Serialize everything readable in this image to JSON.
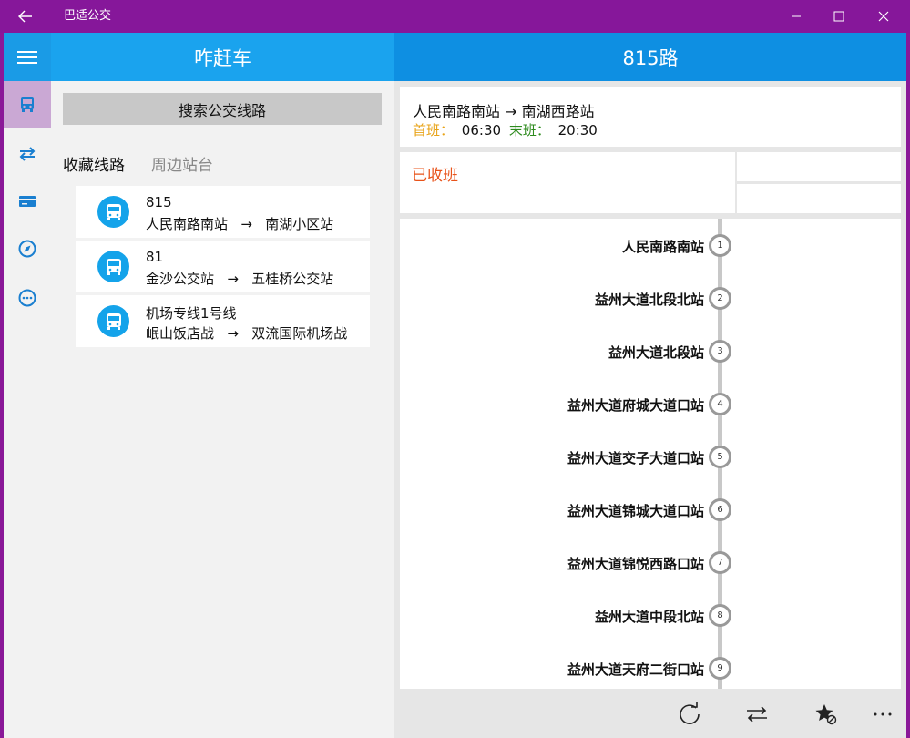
{
  "app": {
    "title": "巴适公交"
  },
  "window_controls": [
    "minimize",
    "maximize",
    "close"
  ],
  "rail": {
    "items": [
      {
        "icon": "bus-icon",
        "active": true
      },
      {
        "icon": "transfer-icon",
        "active": false
      },
      {
        "icon": "card-icon",
        "active": false
      },
      {
        "icon": "compass-icon",
        "active": false
      },
      {
        "icon": "more-circle-icon",
        "active": false
      }
    ]
  },
  "left": {
    "header": "咋赶车",
    "search_label": "搜索公交线路",
    "tabs": [
      "收藏线路",
      "周边站台"
    ],
    "routes": [
      {
        "name": "815",
        "from": "人民南路南站",
        "arrow": "→",
        "to": "南湖小区站"
      },
      {
        "name": "81",
        "from": "金沙公交站",
        "arrow": "→",
        "to": "五桂桥公交站"
      },
      {
        "name": "机场专线1号线",
        "from": "岷山饭店战",
        "arrow": "→",
        "to": "双流国际机场战"
      }
    ]
  },
  "right": {
    "header": "815路",
    "direction": "人民南路南站 → 南湖西路站",
    "first_label": "首班：",
    "first_time": "06:30",
    "last_label": "末班：",
    "last_time": "20:30",
    "status": "已收班",
    "stations": [
      {
        "name": "人民南路南站",
        "num": "1"
      },
      {
        "name": "益州大道北段北站",
        "num": "2"
      },
      {
        "name": "益州大道北段站",
        "num": "3"
      },
      {
        "name": "益州大道府城大道口站",
        "num": "4"
      },
      {
        "name": "益州大道交子大道口站",
        "num": "5"
      },
      {
        "name": "益州大道锦城大道口站",
        "num": "6"
      },
      {
        "name": "益州大道锦悦西路口站",
        "num": "7"
      },
      {
        "name": "益州大道中段北站",
        "num": "8"
      },
      {
        "name": "益州大道天府二街口站",
        "num": "9"
      }
    ],
    "actions": [
      "refresh-icon",
      "swap-direction-icon",
      "favorite-toggle-icon",
      "more-icon"
    ]
  },
  "colors": {
    "titlebar": "#86179a",
    "accent_left": "#1aa3ee",
    "accent_right": "#0e8fe2",
    "first_label": "#e8a317",
    "last_label": "#2e8b1e",
    "status": "#e8531a"
  }
}
